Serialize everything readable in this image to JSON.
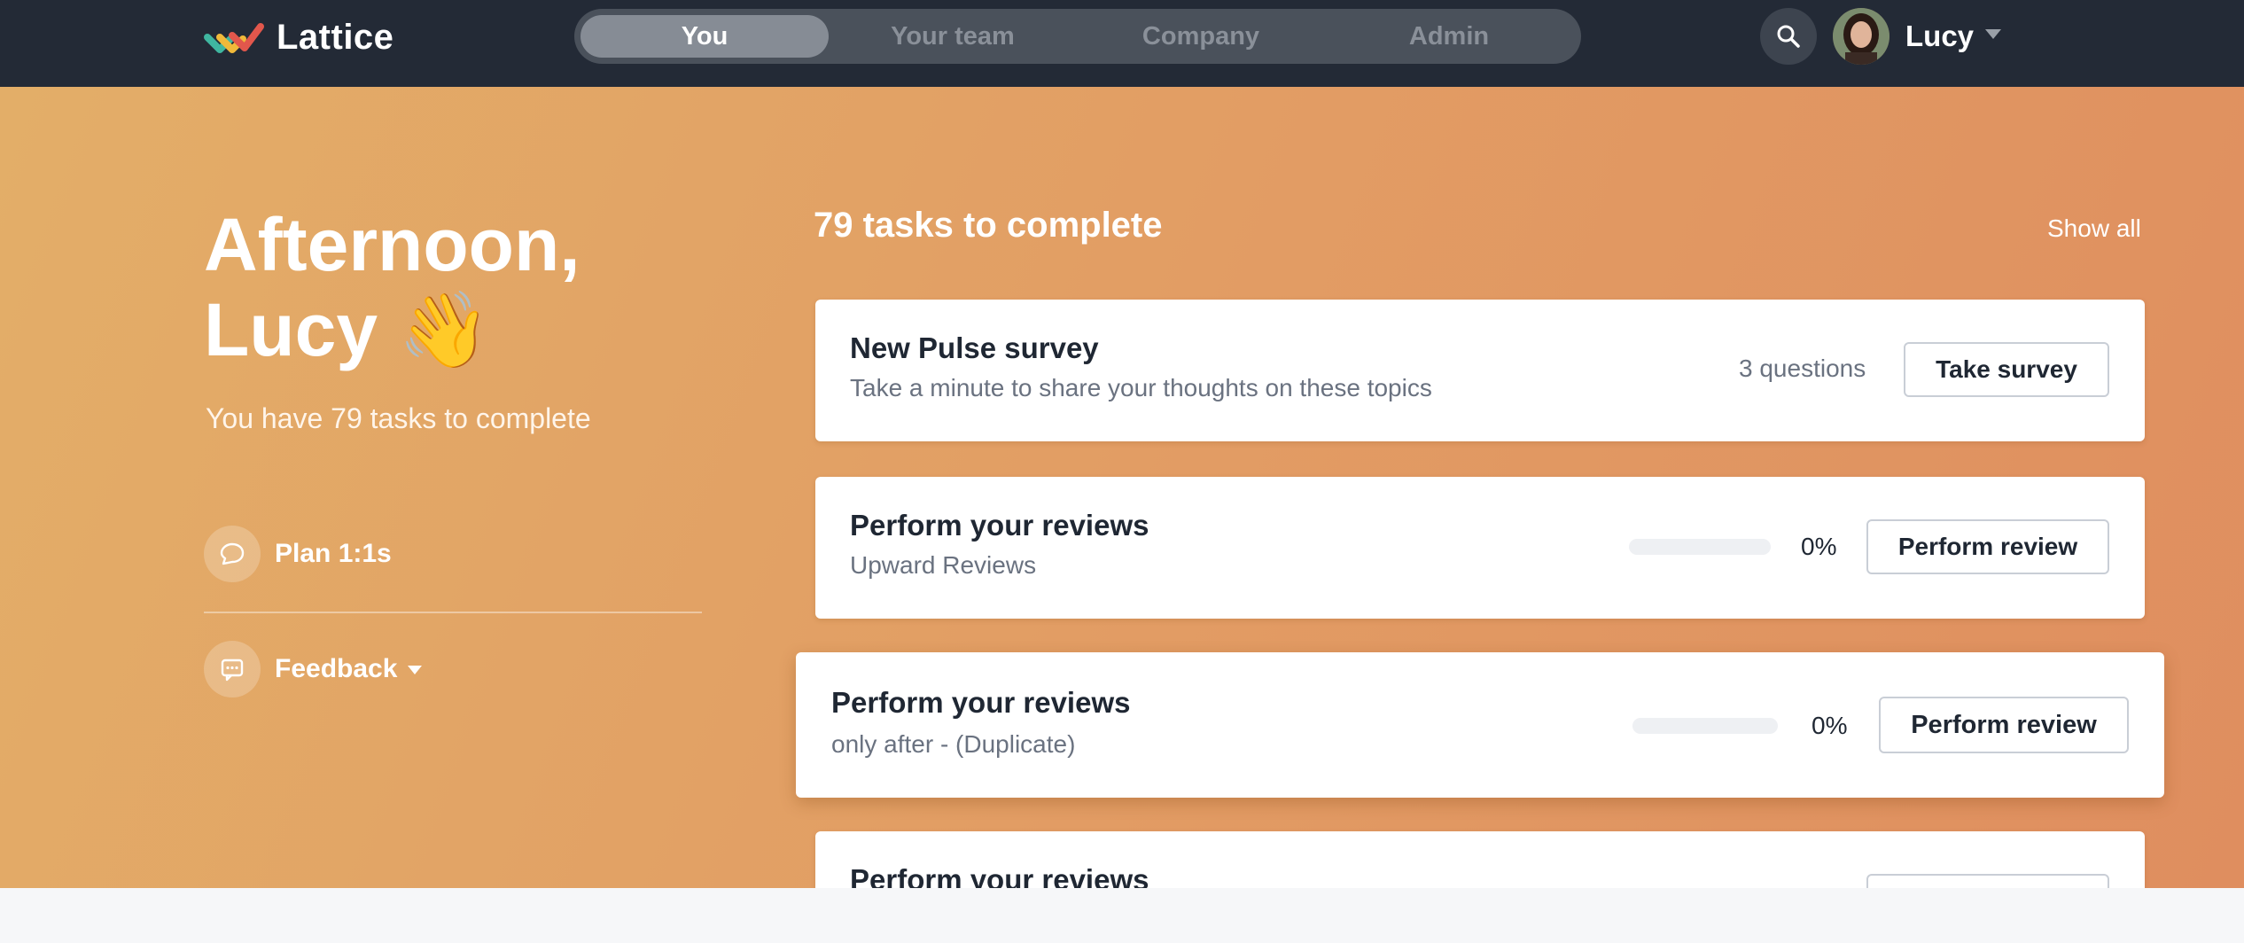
{
  "brand": {
    "name": "Lattice"
  },
  "nav": {
    "tabs": [
      {
        "label": "You",
        "active": true
      },
      {
        "label": "Your team",
        "active": false
      },
      {
        "label": "Company",
        "active": false
      },
      {
        "label": "Admin",
        "active": false
      }
    ],
    "search_icon": "search-icon",
    "user": {
      "name": "Lucy"
    }
  },
  "hero": {
    "greeting_line1": "Afternoon,",
    "greeting_line2": "Lucy 👋",
    "subline": "You have 79 tasks to complete",
    "links": [
      {
        "label": "Plan 1:1s",
        "icon": "chat-bubble-icon"
      },
      {
        "label": "Feedback",
        "icon": "message-icon"
      }
    ]
  },
  "tasks": {
    "heading": "79 tasks to complete",
    "show_all": "Show all",
    "items": [
      {
        "title": "New Pulse survey",
        "subtitle": "Take a minute to share your thoughts on these topics",
        "meta": "3 questions",
        "button": "Take survey"
      },
      {
        "title": "Perform your reviews",
        "subtitle": "Upward Reviews",
        "progress": 0,
        "progress_label": "0%",
        "button": "Perform review"
      },
      {
        "title": "Perform your reviews",
        "subtitle": "only after - (Duplicate)",
        "progress": 0,
        "progress_label": "0%",
        "button": "Perform review"
      },
      {
        "title": "Perform your reviews"
      }
    ]
  },
  "colors": {
    "nav_bg": "#232a36",
    "hero_start": "#e3ae68",
    "hero_end": "#df8e5f"
  }
}
